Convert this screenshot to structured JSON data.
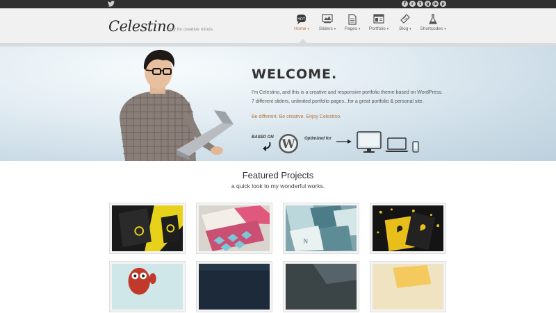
{
  "topbar": {
    "twitter_icon": "twitter-icon",
    "social_icons": [
      "facebook-icon",
      "rss-icon",
      "twitter-icon",
      "googleplus-icon",
      "linkedin-icon",
      "pinterest-icon"
    ],
    "social_glyphs": [
      "f",
      "r",
      "t",
      "g",
      "in",
      "p"
    ]
  },
  "header": {
    "logo": "Celestino",
    "tagline": "only for creative minds",
    "nav": [
      {
        "label": "Home",
        "icon": "home-icon",
        "active": true
      },
      {
        "label": "Sliders",
        "icon": "slider-icon",
        "active": false
      },
      {
        "label": "Pages",
        "icon": "page-icon",
        "active": false
      },
      {
        "label": "Portfolio",
        "icon": "portfolio-icon",
        "active": false
      },
      {
        "label": "Blog",
        "icon": "blog-icon",
        "active": false
      },
      {
        "label": "Shortcodes",
        "icon": "flask-icon",
        "active": false
      }
    ],
    "hot_badge": "HOT"
  },
  "hero": {
    "title": "WELCOME.",
    "desc_line1": "I'm Celestino, and this is a creative and responsive portfolio theme based on WordPress.",
    "desc_line2": "7 different sliders, unlimited portfolio pages...for a great portfolio & personal site.",
    "cta": "Be different. Be creative. Enjoy Celestino.",
    "based_on": "BASED ON",
    "optimized_for": "Optimized for",
    "wordpress_icon": "wordpress-logo-icon",
    "device_icons": [
      "desktop-icon",
      "laptop-icon",
      "phone-icon"
    ]
  },
  "featured": {
    "title": "Featured Projects",
    "subtitle": "a quick look to my wonderful works."
  },
  "colors": {
    "accent": "#b5763b",
    "topbar": "#2f2f2f",
    "header_bg": "#f1f1f1"
  }
}
